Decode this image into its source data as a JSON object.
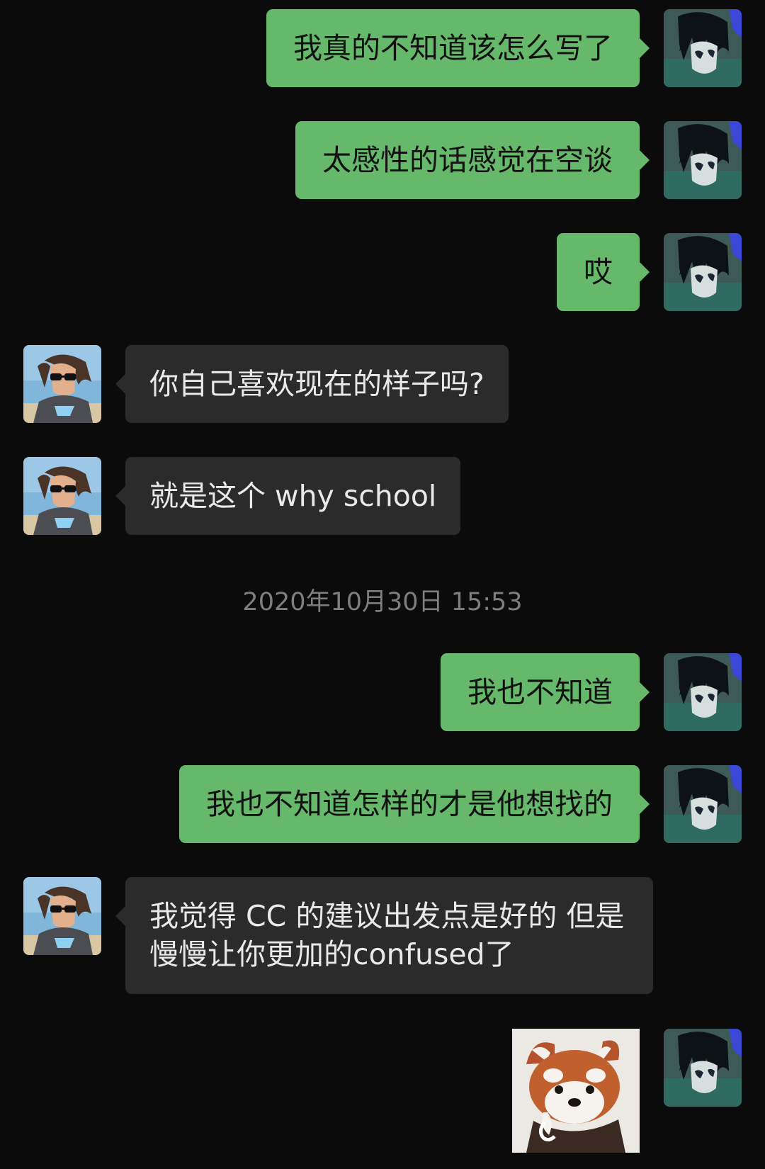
{
  "messages": [
    {
      "side": "me",
      "text": "我真的不知道该怎么写了"
    },
    {
      "side": "me",
      "text": "太感性的话感觉在空谈"
    },
    {
      "side": "me",
      "text": "哎"
    },
    {
      "side": "them",
      "text": "你自己喜欢现在的样子吗?"
    },
    {
      "side": "them",
      "text": "就是这个 why school"
    },
    {
      "timestamp": "2020年10月30日 15:53"
    },
    {
      "side": "me",
      "text": "我也不知道"
    },
    {
      "side": "me",
      "text": "我也不知道怎样的才是他想找的"
    },
    {
      "side": "them",
      "text": "我觉得 CC 的建议出发点是好的 但是慢慢让你更加的confused了"
    },
    {
      "side": "me",
      "sticker": "red-panda-sticker"
    }
  ],
  "icons": {
    "my_avatar": "anime-avatar-icon",
    "their_avatar": "woman-avatar-icon",
    "sticker": "red-panda-sticker"
  },
  "colors": {
    "background": "#0b0b0b",
    "my_bubble": "#66b96b",
    "their_bubble": "#2b2b2b",
    "timestamp": "#7e7e7e"
  }
}
